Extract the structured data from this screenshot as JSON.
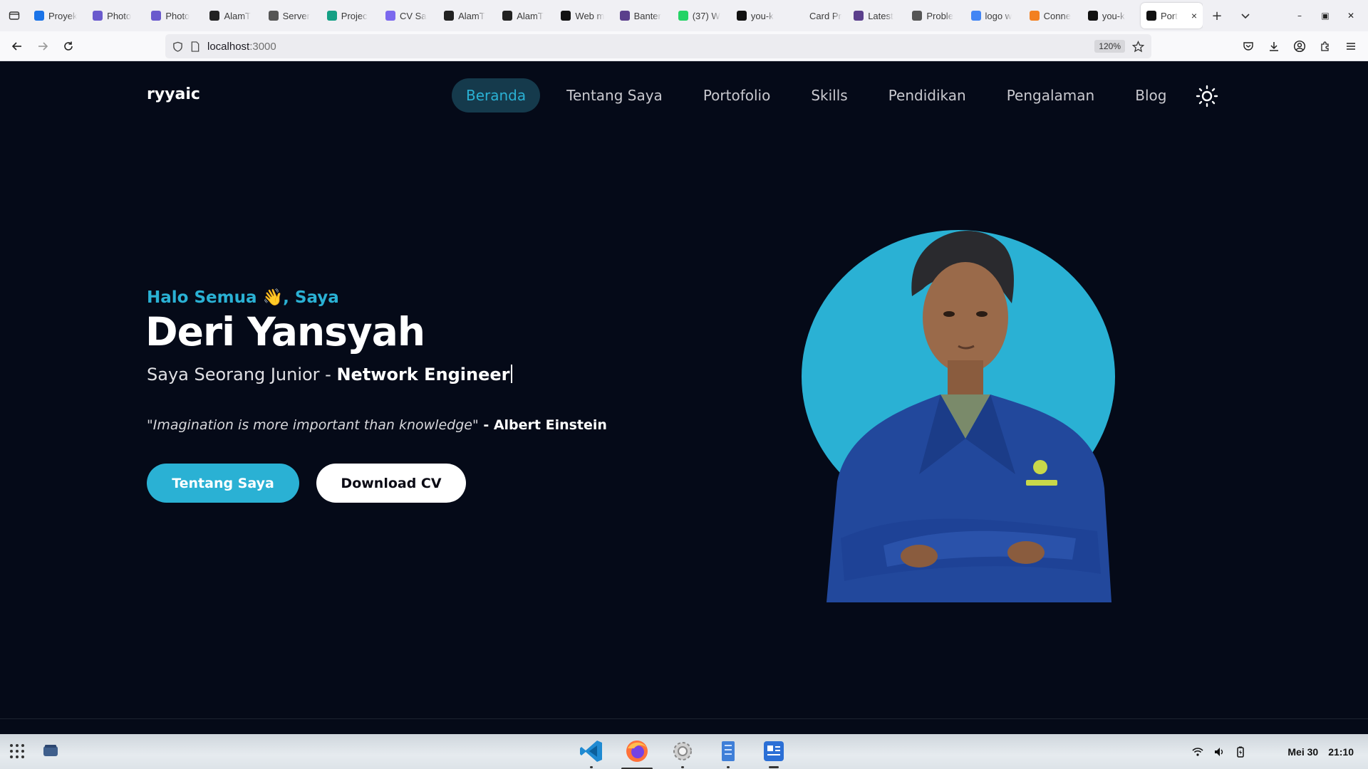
{
  "browser": {
    "tabs": [
      {
        "label": "Proyek",
        "icon": "canva-icon",
        "color": "#1a73e8"
      },
      {
        "label": "Photo",
        "icon": "photo-icon",
        "color": "#6a5acd"
      },
      {
        "label": "Photo",
        "icon": "photo-icon",
        "color": "#6a5acd"
      },
      {
        "label": "AlamT",
        "icon": "alamt-icon",
        "color": "#222222"
      },
      {
        "label": "Server",
        "icon": "info-icon",
        "color": "#555555"
      },
      {
        "label": "Projec",
        "icon": "diamond-icon",
        "color": "#14a085"
      },
      {
        "label": "CV Sa",
        "icon": "cv-icon",
        "color": "#7b68ee"
      },
      {
        "label": "AlamT",
        "icon": "alamt-icon",
        "color": "#222222"
      },
      {
        "label": "AlamT",
        "icon": "alamt-icon",
        "color": "#222222"
      },
      {
        "label": "Web m",
        "icon": "web-icon",
        "color": "#111111"
      },
      {
        "label": "Banter",
        "icon": "banter-icon",
        "color": "#5b3f8c"
      },
      {
        "label": "(37) W",
        "icon": "whatsapp-icon",
        "color": "#25d366"
      },
      {
        "label": "you-k",
        "icon": "github-icon",
        "color": "#111111"
      },
      {
        "label": "Card Proc",
        "icon": "blank-icon",
        "color": "#f0f0f4"
      },
      {
        "label": "Latest",
        "icon": "latest-icon",
        "color": "#5b3f8c"
      },
      {
        "label": "Proble",
        "icon": "info-icon",
        "color": "#555555"
      },
      {
        "label": "logo w",
        "icon": "google-icon",
        "color": "#4285f4"
      },
      {
        "label": "Conne",
        "icon": "cloudflare-icon",
        "color": "#f38020"
      },
      {
        "label": "you-k",
        "icon": "github-icon",
        "color": "#111111"
      },
      {
        "label": "Port",
        "icon": "portfolio-icon",
        "color": "#111111",
        "active": true
      }
    ],
    "url_host": "localhost",
    "url_port": ":3000",
    "zoom": "120%"
  },
  "site": {
    "brand": "ryyaic",
    "menu": [
      "Beranda",
      "Tentang Saya",
      "Portofolio",
      "Skills",
      "Pendidikan",
      "Pengalaman",
      "Blog"
    ],
    "active_menu": "Beranda",
    "accent": "#2ab1d4",
    "background": "#050a18"
  },
  "hero": {
    "greeting": "Halo Semua 👋, Saya",
    "name": "Deri Yansyah",
    "role_prefix": "Saya Seorang Junior - ",
    "role_highlight": "Network Engineer",
    "quote_text": "\"Imagination is more important than knowledge\"",
    "quote_author": " - Albert Einstein",
    "primary_button": "Tentang Saya",
    "secondary_button": "Download CV"
  },
  "taskbar": {
    "date": "Mei 30",
    "time": "21:10",
    "apps": [
      "vscode-icon",
      "firefox-icon",
      "settings-icon",
      "files-icon",
      "docs-icon"
    ]
  }
}
